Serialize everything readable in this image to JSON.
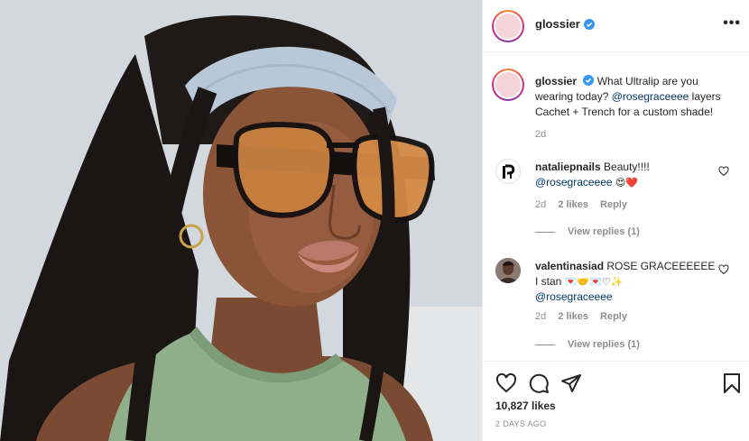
{
  "post": {
    "author": "glossier",
    "verified": true,
    "more_label": "•••"
  },
  "caption": {
    "author": "glossier",
    "text_prefix": "What Ultralip are you wearing today? ",
    "mention": "@rosegraceeee",
    "text_suffix": " layers Cachet + Trench for a custom shade!",
    "time": "2d"
  },
  "comments": [
    {
      "user": "nataliepnails",
      "text": "Beauty!!!!",
      "mention": "@rosegraceeee",
      "emoji": "😍❤️",
      "time": "2d",
      "likes": "2 likes",
      "reply_label": "Reply",
      "view_replies": "View replies (1)",
      "avatar_letters": "NP"
    },
    {
      "user": "valentinasiad",
      "text": "ROSE GRACEEEEEE",
      "line2_prefix": "I stan ",
      "emoji": "💌🤝💌♡✨",
      "mention": "@rosegraceeee",
      "time": "2d",
      "likes": "2 likes",
      "reply_label": "Reply",
      "view_replies": "View replies (1)"
    }
  ],
  "footer": {
    "likes": "10,827 likes",
    "timeago": "2 DAYS AGO"
  },
  "icons": {
    "like": "heart-icon",
    "comment": "comment-icon",
    "share": "share-icon",
    "save": "bookmark-icon",
    "verified": "verified-badge-icon"
  },
  "colors": {
    "verified": "#3897f0",
    "mention": "#00376b",
    "muted": "#8e8e8e",
    "heart_red": "#ed4956"
  }
}
